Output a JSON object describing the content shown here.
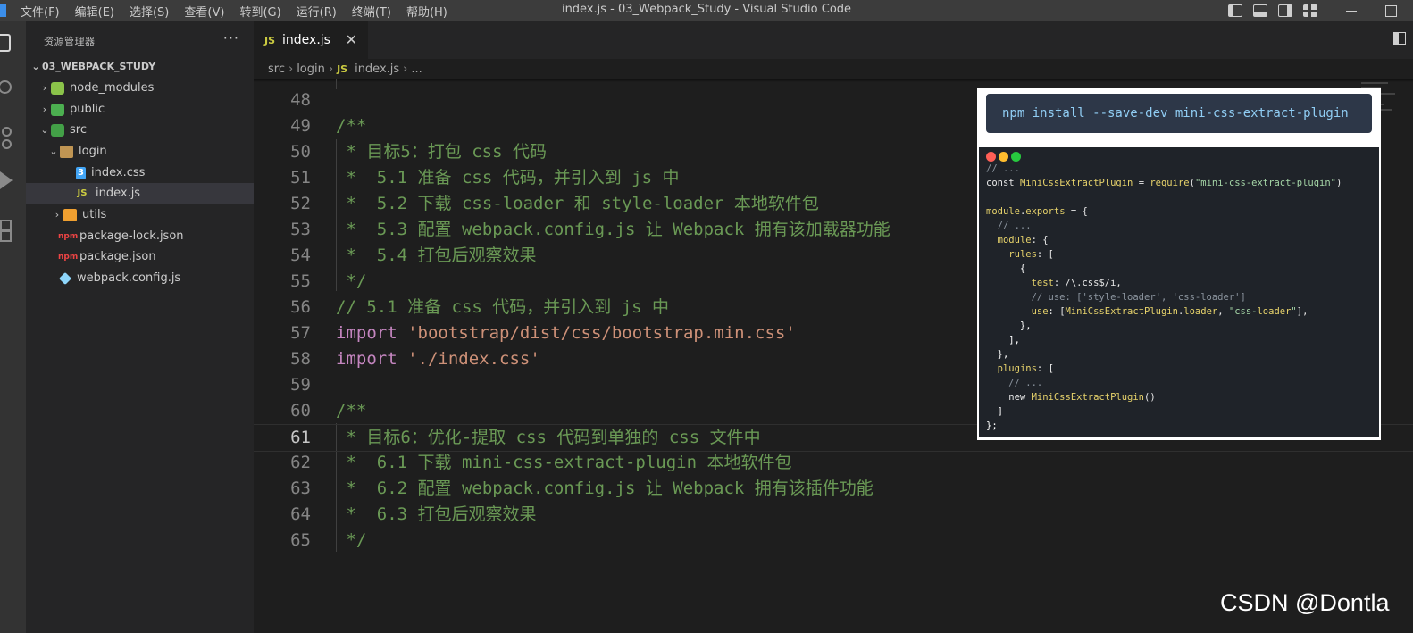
{
  "window": {
    "title": "index.js - 03_Webpack_Study - Visual Studio Code",
    "menu": [
      "文件(F)",
      "编辑(E)",
      "选择(S)",
      "查看(V)",
      "转到(G)",
      "运行(R)",
      "终端(T)",
      "帮助(H)"
    ]
  },
  "sidebar": {
    "title": "资源管理器",
    "more": "···",
    "root": "03_WEBPACK_STUDY",
    "items": [
      {
        "label": "node_modules",
        "icon": "node-folder-icon",
        "chevron": "›"
      },
      {
        "label": "public",
        "icon": "public-folder-icon",
        "chevron": "›"
      },
      {
        "label": "src",
        "icon": "src-folder-icon",
        "chevron": "⌄"
      },
      {
        "label": "login",
        "icon": "folder-open-icon",
        "chevron": "⌄"
      },
      {
        "label": "index.css",
        "icon": "css-file-icon",
        "badge": "3"
      },
      {
        "label": "index.js",
        "icon": "js-file-icon",
        "badge": "JS"
      },
      {
        "label": "utils",
        "icon": "utils-folder-icon",
        "chevron": "›"
      },
      {
        "label": "package-lock.json",
        "icon": "npm-file-icon",
        "badge": "npm"
      },
      {
        "label": "package.json",
        "icon": "npm-file-icon",
        "badge": "npm"
      },
      {
        "label": "webpack.config.js",
        "icon": "webpack-file-icon"
      }
    ]
  },
  "tabs": [
    {
      "label": "index.js",
      "badge": "JS",
      "close": "✕"
    }
  ],
  "breadcrumb": {
    "parts": [
      "src",
      "login",
      "index.js",
      "..."
    ],
    "sep": "›",
    "badge": "JS"
  },
  "editor": {
    "active_line": 61,
    "lines": [
      {
        "n": "48",
        "code": ""
      },
      {
        "n": "49",
        "code": "/**"
      },
      {
        "n": "50",
        "code": " * 目标5：打包 css 代码"
      },
      {
        "n": "51",
        "code": " *  5.1 准备 css 代码，并引入到 js 中"
      },
      {
        "n": "52",
        "code": " *  5.2 下载 css-loader 和 style-loader 本地软件包"
      },
      {
        "n": "53",
        "code": " *  5.3 配置 webpack.config.js 让 Webpack 拥有该加载器功能"
      },
      {
        "n": "54",
        "code": " *  5.4 打包后观察效果"
      },
      {
        "n": "55",
        "code": " */"
      },
      {
        "n": "56",
        "code": "// 5.1 准备 css 代码，并引入到 js 中"
      },
      {
        "n": "57",
        "kw": "import",
        "str": "'bootstrap/dist/css/bootstrap.min.css'"
      },
      {
        "n": "58",
        "kw": "import",
        "str": "'./index.css'"
      },
      {
        "n": "59",
        "code": ""
      },
      {
        "n": "60",
        "code": "/**"
      },
      {
        "n": "61",
        "code": " * 目标6：优化-提取 css 代码到单独的 css 文件中"
      },
      {
        "n": "62",
        "code": " *  6.1 下载 mini-css-extract-plugin 本地软件包"
      },
      {
        "n": "63",
        "code": " *  6.2 配置 webpack.config.js 让 Webpack 拥有该插件功能"
      },
      {
        "n": "64",
        "code": " *  6.3 打包后观察效果"
      },
      {
        "n": "65",
        "code": " */"
      }
    ]
  },
  "overlay": {
    "npm_command": "npm install --save-dev mini-css-extract-plugin",
    "dot_colors": [
      "#ff5f56",
      "#ffbd2e",
      "#27c93f"
    ],
    "code": [
      {
        "t": "// ...",
        "c": "g"
      },
      {
        "t": "const MiniCssExtractPlugin = require(\"mini-css-extract-plugin\")",
        "c": "mix1"
      },
      {
        "t": "",
        "c": "w"
      },
      {
        "t": "module.exports = {",
        "c": "mix2"
      },
      {
        "t": "  // ...",
        "c": "g"
      },
      {
        "t": "  module: {",
        "c": "mix3"
      },
      {
        "t": "    rules: [",
        "c": "mix3"
      },
      {
        "t": "      {",
        "c": "w"
      },
      {
        "t": "        test: /\\.css$/i,",
        "c": "mix4"
      },
      {
        "t": "        // use: ['style-loader', 'css-loader']",
        "c": "g"
      },
      {
        "t": "        use: [MiniCssExtractPlugin.loader, \"css-loader\"],",
        "c": "mix5"
      },
      {
        "t": "      },",
        "c": "w"
      },
      {
        "t": "    ],",
        "c": "w"
      },
      {
        "t": "  },",
        "c": "w"
      },
      {
        "t": "  plugins: [",
        "c": "mix3"
      },
      {
        "t": "    // ...",
        "c": "g"
      },
      {
        "t": "    new MiniCssExtractPlugin()",
        "c": "mix6"
      },
      {
        "t": "  ]",
        "c": "w"
      },
      {
        "t": "};",
        "c": "w"
      }
    ]
  },
  "watermark": "CSDN @Dontla",
  "colors": {
    "comment": "#6a9955",
    "keyword": "#c586c0",
    "string": "#ce9178",
    "accent": "#3b8eea"
  }
}
